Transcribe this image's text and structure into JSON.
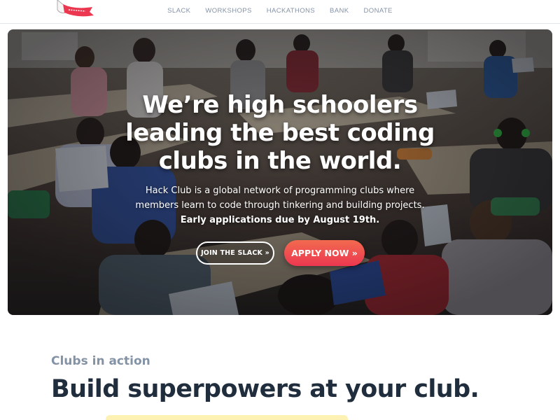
{
  "nav": {
    "items": [
      "SLACK",
      "WORKSHOPS",
      "HACKATHONS",
      "BANK",
      "DONATE"
    ]
  },
  "hero": {
    "headline_lines": [
      "We’re high schoolers",
      "leading the best coding",
      "clubs in the world."
    ],
    "lead_lines": [
      "Hack Club is a global network of programming clubs where",
      "members learn to code through tinkering and building projects."
    ],
    "deadline": "Early applications due by August 19th.",
    "slack_button": "JOIN THE SLACK »",
    "apply_button": "APPLY NOW »"
  },
  "section": {
    "kicker": "Clubs in action",
    "title": "Build superpowers at your club."
  },
  "colors": {
    "brand_red": "#ec3750",
    "brand_orange": "#f26a4f",
    "muted": "#8492a6",
    "ink": "#1f2d3d"
  }
}
